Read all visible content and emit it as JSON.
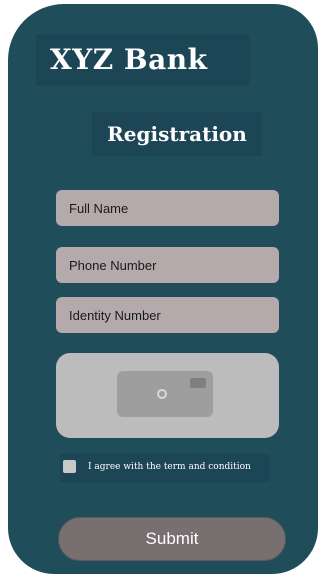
{
  "brand": {
    "title": "XYZ Bank"
  },
  "form": {
    "title": "Registration",
    "full_name": {
      "placeholder": "Full Name",
      "value": ""
    },
    "phone_number": {
      "placeholder": "Phone Number",
      "value": ""
    },
    "identity_number": {
      "placeholder": "Identity Number",
      "value": ""
    },
    "photo_capture": {
      "icon": "camera-icon"
    },
    "agree": {
      "label": "I agree with the term and condition",
      "checked": false
    },
    "submit_label": "Submit"
  },
  "colors": {
    "card_background": "#1f4d5a",
    "title_block": "#1c4656",
    "input_fill": "#b4aaac",
    "photo_area": "#bcbcbc",
    "submit_button": "#786f70"
  }
}
